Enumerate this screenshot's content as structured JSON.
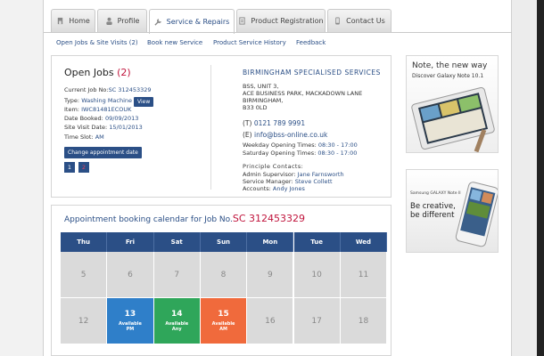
{
  "tabs": [
    {
      "label": "Home",
      "icon": "home-icon",
      "active": false
    },
    {
      "label": "Profile",
      "icon": "user-icon",
      "active": false
    },
    {
      "label": "Service & Repairs",
      "icon": "wrench-icon",
      "active": true
    },
    {
      "label": "Product Registration",
      "icon": "document-icon",
      "active": false
    },
    {
      "label": "Contact Us",
      "icon": "phone-icon",
      "active": false
    }
  ],
  "subnav": [
    "Open Jobs & Site Visits (2)",
    "Book new Service",
    "Product Service History",
    "Feedback"
  ],
  "open_jobs": {
    "title": "Open Jobs",
    "count": "(2)",
    "current_job_label": "Current Job No:",
    "current_job_value": "SC 312453329",
    "type_label": "Type:",
    "type_value": "Washing Machine",
    "view_label": "View",
    "item_label": "Item:",
    "item_value": "IWC81481ECOUK",
    "date_booked_label": "Date Booked:",
    "date_booked_value": "09/09/2013",
    "site_visit_label": "Site Visit Date:",
    "site_visit_value": "15/01/2013",
    "time_slot_label": "Time Slot:",
    "time_slot_value": "AM",
    "change_button": "Change appointment date",
    "pages": [
      "1",
      "2"
    ]
  },
  "provider": {
    "name": "BIRMINGHAM SPECIALISED SERVICES",
    "address": [
      "BSS, UNIT 3,",
      "ACE BUSINESS PARK, MACKADOWN LANE",
      "BIRMINGHAM,",
      "B33 0LD"
    ],
    "phone_prefix": "(T)",
    "phone": "0121 789 9991",
    "email_prefix": "(E)",
    "email": "info@bss-online.co.uk",
    "weekday_label": "Weekday Opening Times:",
    "weekday_value": "08:30 - 17:00",
    "saturday_label": "Saturday Opening Times:",
    "saturday_value": "08:30 - 17:00",
    "contacts_heading": "Principle Contacts:",
    "admin_label": "Admin Supervisor:",
    "admin_value": "Jane Farnsworth",
    "service_label": "Service Manager:",
    "service_value": "Steve Collett",
    "accounts_label": "Accounts:",
    "accounts_value": "Andy Jones"
  },
  "ads": {
    "ad1_title": "Note, the new way",
    "ad1_sub": "Discover Galaxy Note 10.1",
    "ad2_brand": "Samsung GALAXY Note II",
    "ad2_line1": "Be creative,",
    "ad2_line2": "be different"
  },
  "calendar": {
    "heading": "Appointment booking calendar for Job No.",
    "job_no": "SC 312453329",
    "days": [
      "Thu",
      "Fri",
      "Sat",
      "Sun",
      "Mon",
      "Tue",
      "Wed"
    ],
    "row1": [
      "5",
      "6",
      "7",
      "8",
      "9",
      "10",
      "11"
    ],
    "row2": [
      {
        "num": "12",
        "l1": "",
        "l2": ""
      },
      {
        "num": "13",
        "l1": "Available",
        "l2": "PM",
        "color": "#2f7fc9"
      },
      {
        "num": "14",
        "l1": "Available",
        "l2": "Any",
        "color": "#2fa65a"
      },
      {
        "num": "15",
        "l1": "Available",
        "l2": "AM",
        "color": "#f06a3c"
      },
      {
        "num": "16",
        "l1": "",
        "l2": ""
      },
      {
        "num": "17",
        "l1": "",
        "l2": ""
      },
      {
        "num": "18",
        "l1": "",
        "l2": ""
      }
    ]
  },
  "colors": {
    "accent": "#2b4f86",
    "highlight": "#c0143c"
  }
}
